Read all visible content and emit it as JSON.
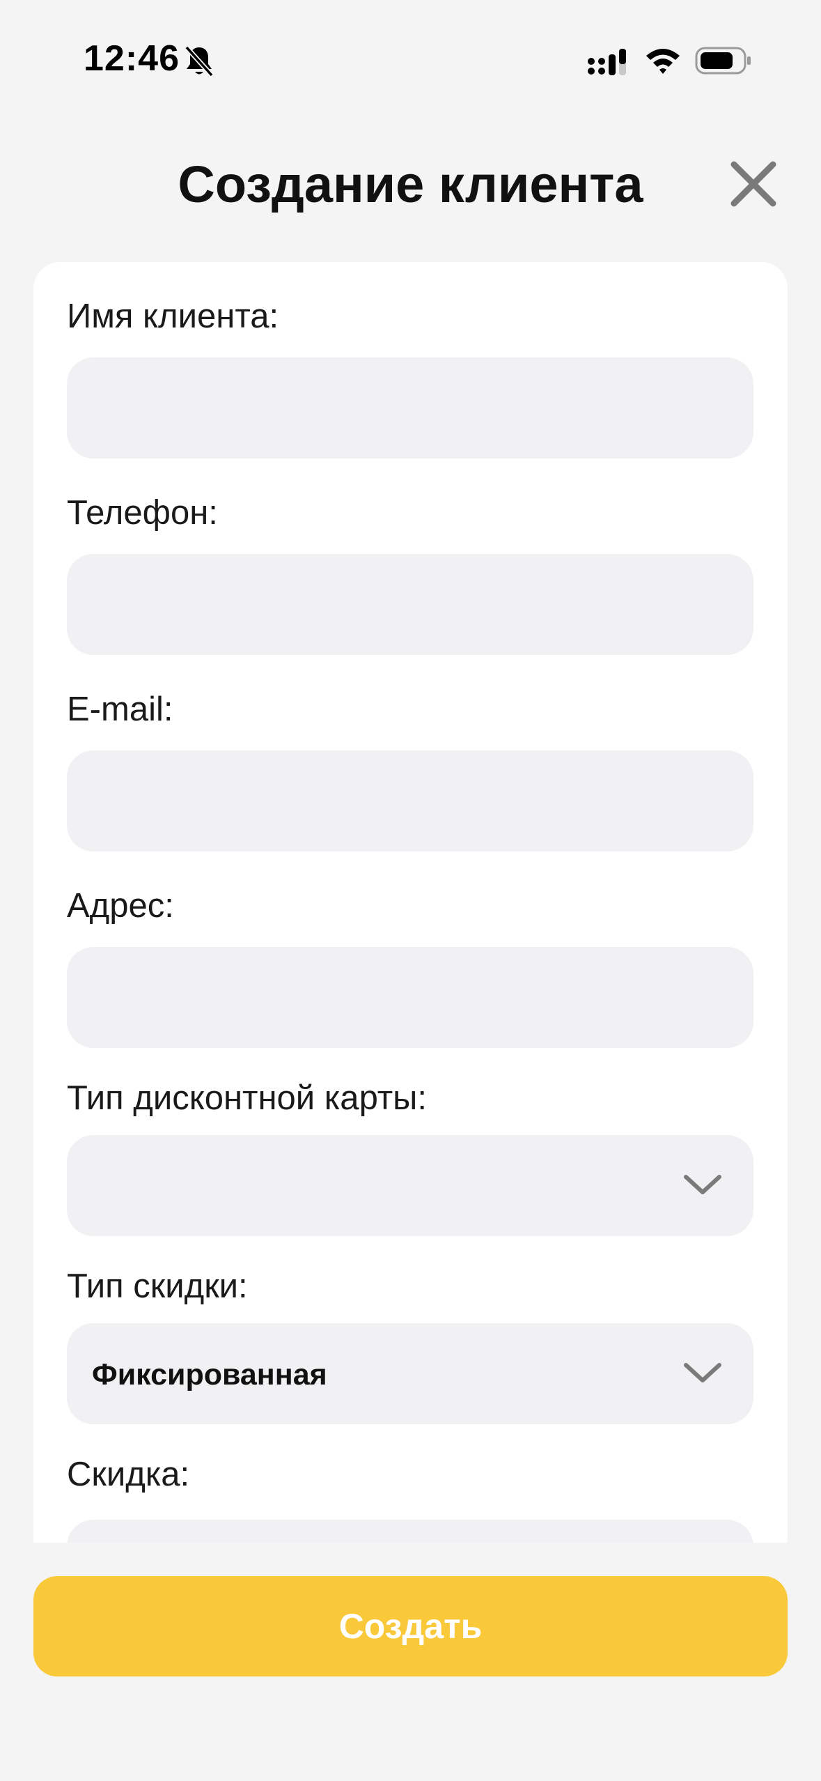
{
  "status_bar": {
    "time": "12:46",
    "icons": [
      "bell-slash-icon",
      "cellular-icon",
      "wifi-icon",
      "battery-icon"
    ]
  },
  "header": {
    "title": "Создание клиента",
    "close_icon": "close-icon"
  },
  "form": {
    "name_label": "Имя клиента:",
    "name_value": "",
    "phone_label": "Телефон:",
    "phone_value": "",
    "email_label": "E-mail:",
    "email_value": "",
    "address_label": "Адрес:",
    "address_value": "",
    "card_type_label": "Тип дисконтной карты:",
    "card_type_value": "",
    "discount_type_label": "Тип скидки:",
    "discount_type_value": "Фиксированная",
    "discount_label": "Скидка:"
  },
  "actions": {
    "create_label": "Создать"
  },
  "colors": {
    "background": "#f4f4f5",
    "card": "#ffffff",
    "input": "#f1f1f3",
    "accent": "#f9c93a",
    "icon_gray": "#7a7a7a"
  }
}
